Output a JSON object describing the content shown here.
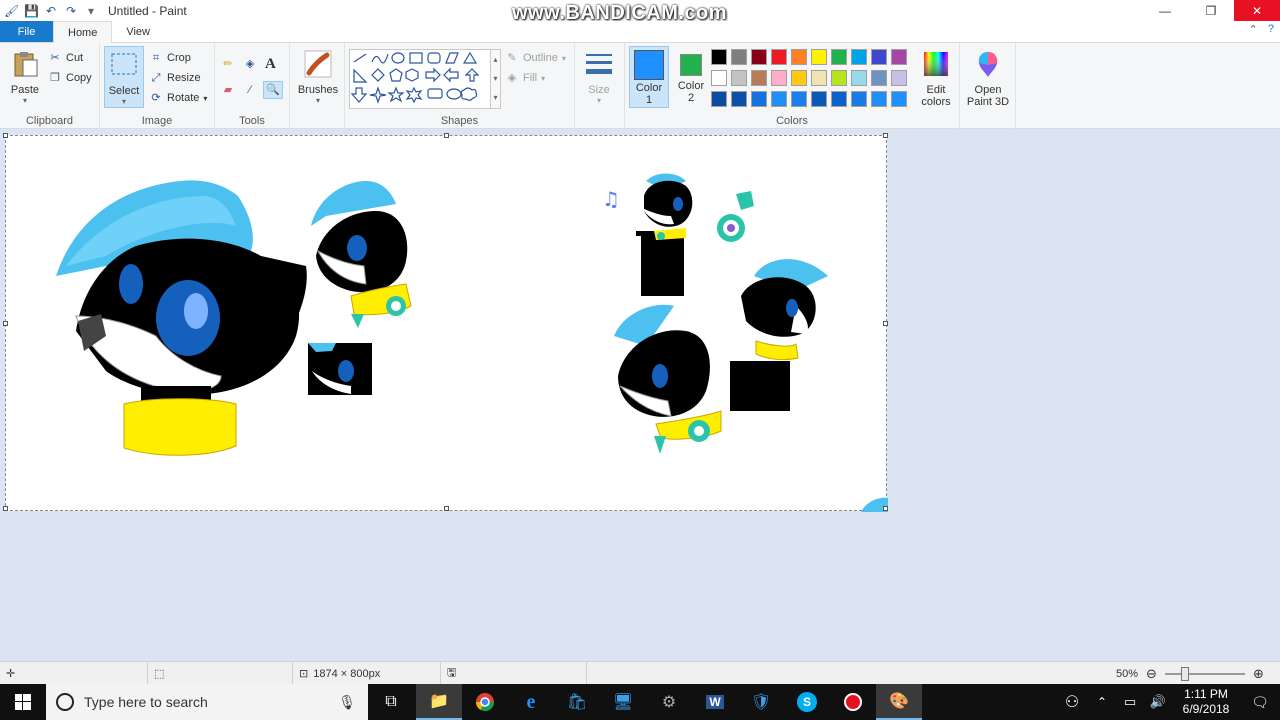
{
  "window": {
    "title": "Untitled - Paint",
    "watermark": "www.BANDICAM.com"
  },
  "tabs": [
    {
      "label": "File"
    },
    {
      "label": "Home"
    },
    {
      "label": "View"
    }
  ],
  "ribbon": {
    "clipboard": {
      "label": "Clipboard",
      "paste": "Paste",
      "cut": "Cut",
      "copy": "Copy"
    },
    "image": {
      "label": "Image",
      "select": "Select",
      "crop": "Crop",
      "resize": "Resize",
      "rotate": "Rotate"
    },
    "tools": {
      "label": "Tools"
    },
    "brushes": {
      "label": "Brushes"
    },
    "shapes": {
      "label": "Shapes",
      "outline": "Outline",
      "fill": "Fill"
    },
    "size": {
      "label": "Size"
    },
    "colors": {
      "label": "Colors",
      "color1_label": "Color",
      "color1_num": "1",
      "color2_label": "Color",
      "color2_num": "2",
      "color1": "#1e90ff",
      "color2": "#22b14c",
      "edit": "Edit colors",
      "palette_row1": [
        "#000000",
        "#7f7f7f",
        "#880015",
        "#ed1c24",
        "#ff7f27",
        "#fff200",
        "#22b14c",
        "#00a2e8",
        "#3f48cc",
        "#a349a4"
      ],
      "palette_row2": [
        "#ffffff",
        "#c3c3c3",
        "#b97a57",
        "#ffaec9",
        "#ffc90e",
        "#efe4b0",
        "#b5e61d",
        "#99d9ea",
        "#7092be",
        "#c8bfe7"
      ],
      "palette_row3": [
        "#0a4ca0",
        "#0b4fa6",
        "#1573e0",
        "#1f8ef5",
        "#1a80ee",
        "#0a58b8",
        "#0c62c8",
        "#1a7ae6",
        "#1f8ff6",
        "#1e90ff"
      ]
    },
    "paint3d": {
      "label": "Open Paint 3D"
    }
  },
  "status": {
    "dimensions": "1874 × 800px",
    "zoom": "50%"
  },
  "taskbar": {
    "search_placeholder": "Type here to search",
    "time": "1:11 PM",
    "date": "6/9/2018"
  }
}
